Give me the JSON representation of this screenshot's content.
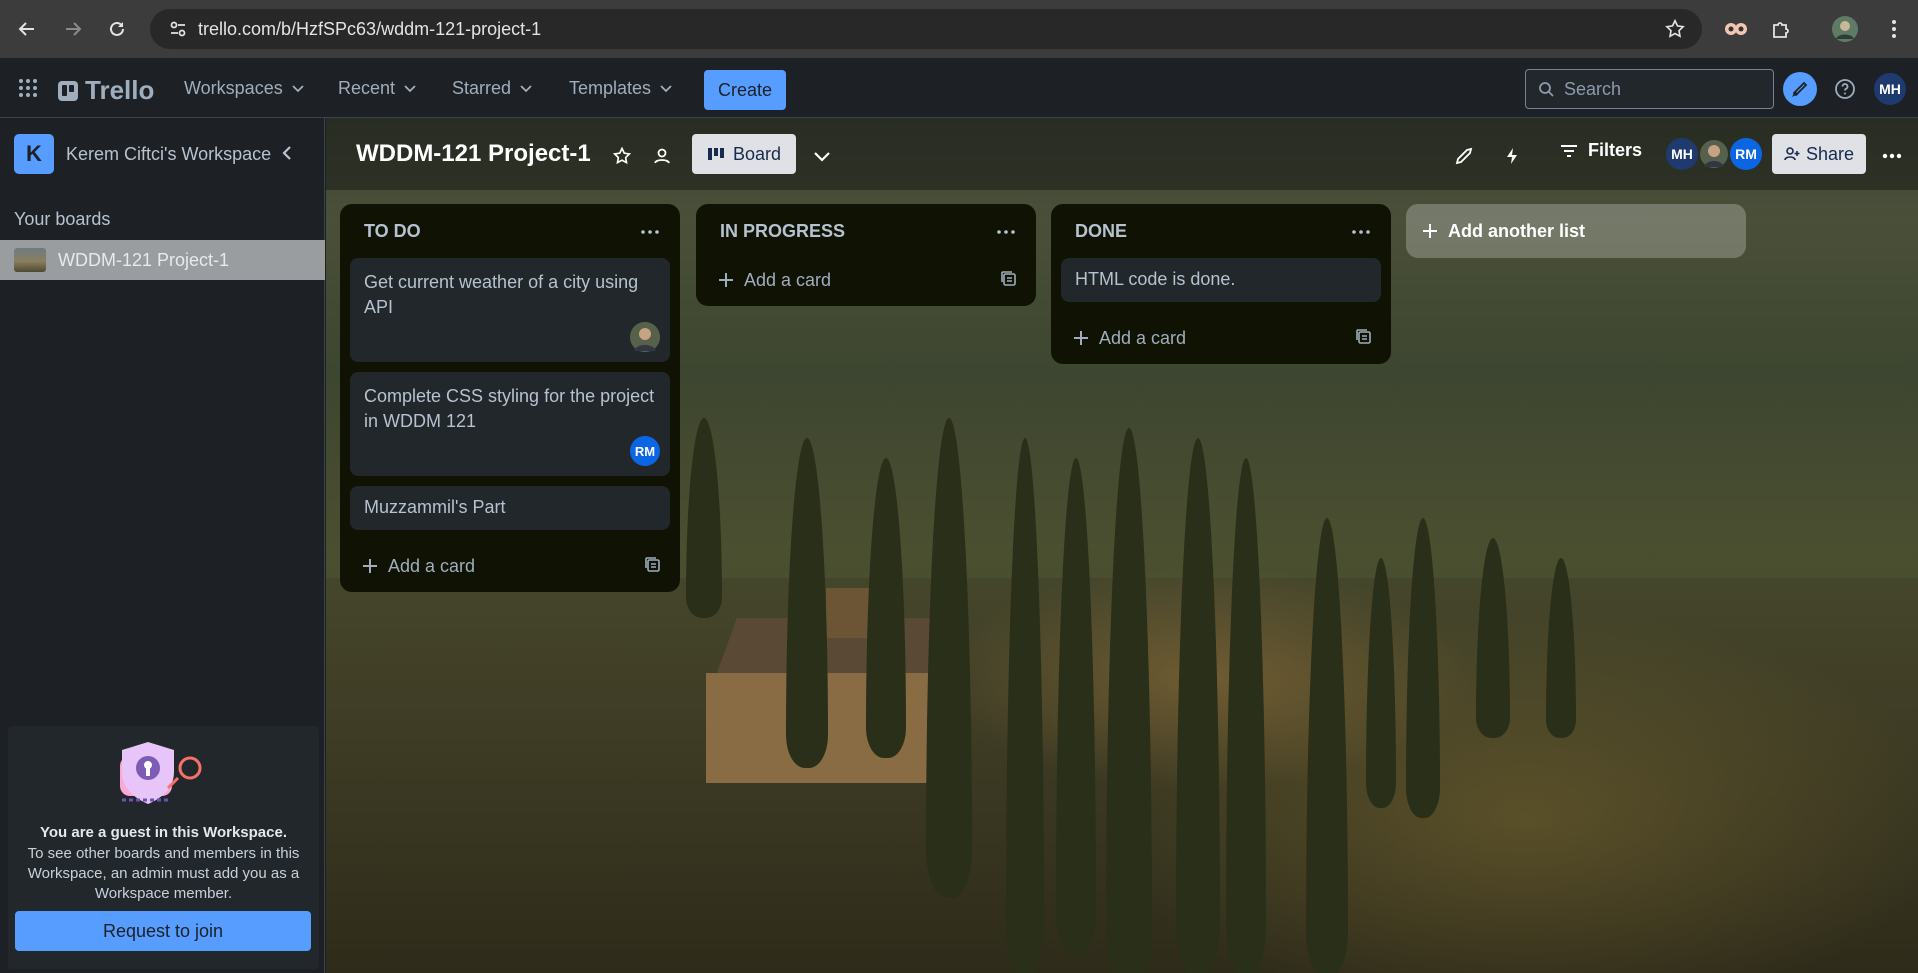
{
  "browser": {
    "url": "trello.com/b/HzfSPc63/wddm-121-project-1"
  },
  "header": {
    "logo": "Trello",
    "menus": [
      "Workspaces",
      "Recent",
      "Starred",
      "Templates"
    ],
    "create_label": "Create",
    "search_placeholder": "Search",
    "user_initials": "MH"
  },
  "sidebar": {
    "workspace_initial": "K",
    "workspace_name": "Kerem Ciftci's Workspace",
    "your_boards_label": "Your boards",
    "boards": [
      {
        "label": "WDDM-121 Project-1"
      }
    ],
    "guest": {
      "title": "You are a guest in this Workspace.",
      "text": "To see other boards and members in this Workspace, an admin must add you as a Workspace member.",
      "join_label": "Request to join"
    }
  },
  "board": {
    "title": "WDDM-121 Project-1",
    "view_label": "Board",
    "filters_label": "Filters",
    "members": [
      "MH",
      "RM"
    ],
    "share_label": "Share",
    "add_list_label": "Add another list",
    "add_card_label": "Add a card",
    "lists": [
      {
        "title": "TO DO",
        "cards": [
          {
            "text": "Get current weather of a city using API",
            "member": "photo"
          },
          {
            "text": "Complete CSS styling for the project in WDDM 121",
            "member": "RM"
          },
          {
            "text": "Muzzammil's Part",
            "member": ""
          }
        ]
      },
      {
        "title": "IN PROGRESS",
        "cards": []
      },
      {
        "title": "DONE",
        "cards": [
          {
            "text": "HTML code is done.",
            "member": ""
          }
        ]
      }
    ]
  },
  "colors": {
    "accent": "#579dff",
    "avatar_mh": "#1f3a6e",
    "avatar_rm": "#0c66e4"
  }
}
